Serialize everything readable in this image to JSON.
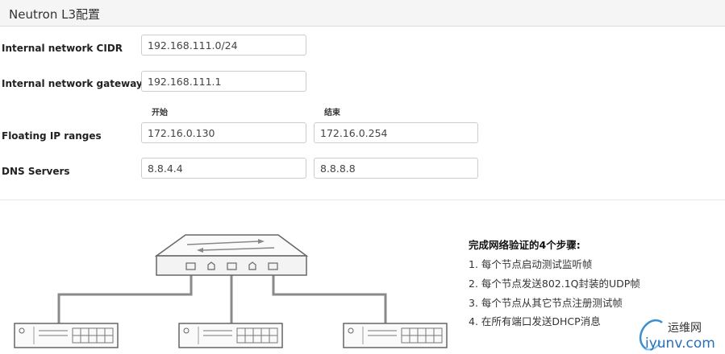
{
  "header": {
    "title": "Neutron L3配置"
  },
  "form": {
    "cidr_label": "Internal network CIDR",
    "cidr_value": "192.168.111.0/24",
    "gateway_label": "Internal network gateway",
    "gateway_value": "192.168.111.1",
    "range_start_label": "开始",
    "range_end_label": "结束",
    "floating_label": "Floating IP ranges",
    "floating_start": "172.16.0.130",
    "floating_end": "172.16.0.254",
    "dns_label": "DNS Servers",
    "dns_primary": "8.8.4.4",
    "dns_secondary": "8.8.8.8"
  },
  "verification": {
    "title": "完成网络验证的4个步骤:",
    "steps": [
      "1. 每个节点启动测试监听帧",
      "2. 每个节点发送802.1Q封装的UDP帧",
      "3. 每个节点从其它节点注册测试帧",
      "4. 在所有端口发送DHCP消息"
    ]
  },
  "watermark": {
    "name": "运维网",
    "url": "iyunv.com"
  }
}
